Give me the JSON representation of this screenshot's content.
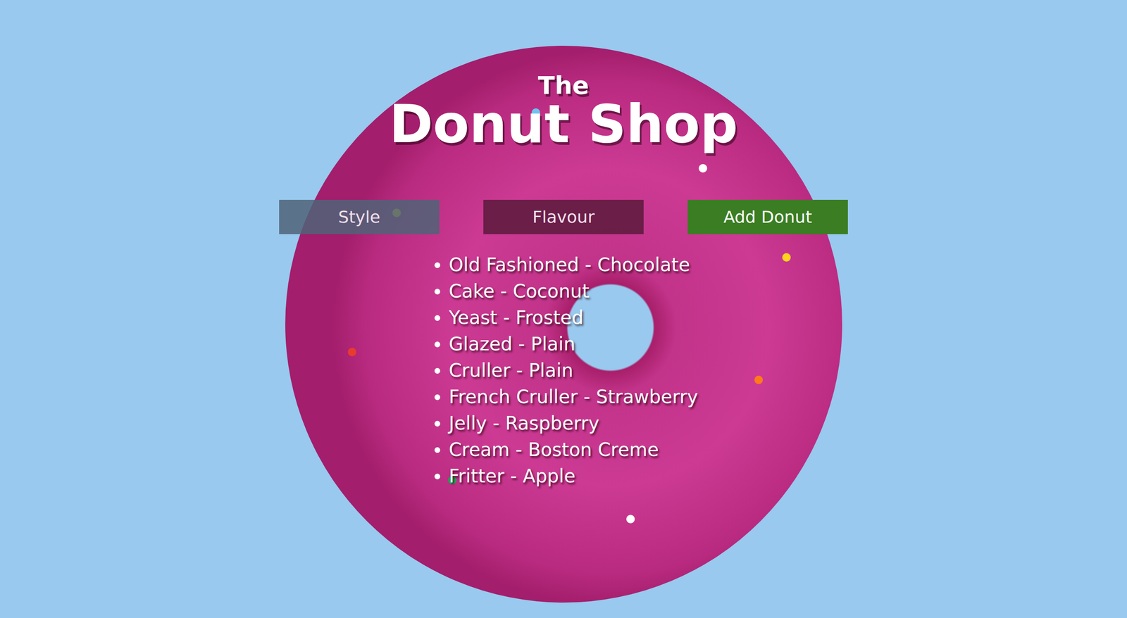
{
  "header": {
    "small": "The",
    "title": "Donut Shop"
  },
  "fields": [
    {
      "name": "style",
      "placeholder": "Style",
      "color": "#4f6478"
    },
    {
      "name": "flavour",
      "placeholder": "Flavour",
      "color": "#5a1a3c"
    }
  ],
  "add_button": "Add Donut",
  "donuts": [
    "Old Fashioned - Chocolate",
    "Cake - Coconut",
    "Yeast - Frosted",
    "Glazed - Plain",
    "Cruller - Plain",
    "French Cruller - Strawberry",
    "Jelly - Raspberry",
    "Cream - Boston Creme",
    "Fritter - Apple"
  ]
}
